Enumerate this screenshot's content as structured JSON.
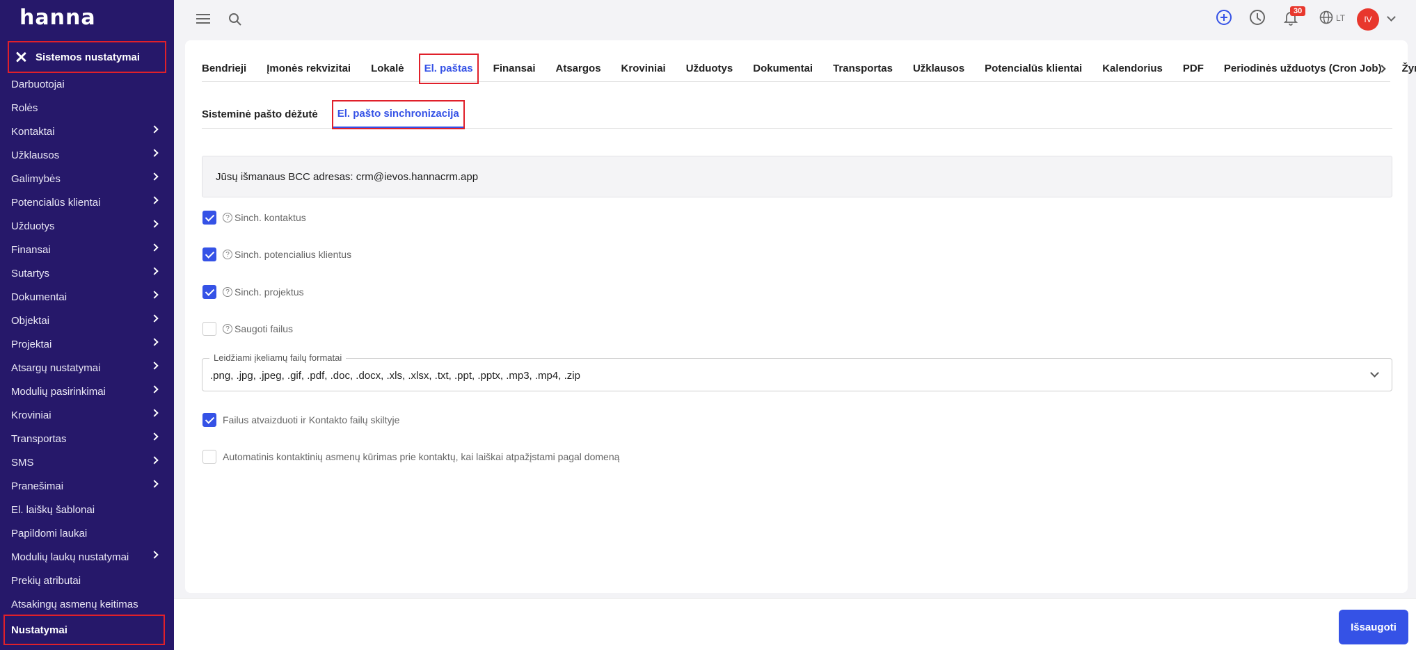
{
  "app": {
    "logo": "hanna"
  },
  "sidebar": {
    "header_label": "Sistemos nustatymai",
    "items": [
      {
        "label": "Darbuotojai",
        "chevron": false
      },
      {
        "label": "Rolės",
        "chevron": false
      },
      {
        "label": "Kontaktai",
        "chevron": true
      },
      {
        "label": "Užklausos",
        "chevron": true
      },
      {
        "label": "Galimybės",
        "chevron": true
      },
      {
        "label": "Potencialūs klientai",
        "chevron": true
      },
      {
        "label": "Užduotys",
        "chevron": true
      },
      {
        "label": "Finansai",
        "chevron": true
      },
      {
        "label": "Sutartys",
        "chevron": true
      },
      {
        "label": "Dokumentai",
        "chevron": true
      },
      {
        "label": "Objektai",
        "chevron": true
      },
      {
        "label": "Projektai",
        "chevron": true
      },
      {
        "label": "Atsargų nustatymai",
        "chevron": true
      },
      {
        "label": "Modulių pasirinkimai",
        "chevron": true
      },
      {
        "label": "Kroviniai",
        "chevron": true
      },
      {
        "label": "Transportas",
        "chevron": true
      },
      {
        "label": "SMS",
        "chevron": true
      },
      {
        "label": "Pranešimai",
        "chevron": true
      },
      {
        "label": "El. laiškų šablonai",
        "chevron": false
      },
      {
        "label": "Papildomi laukai",
        "chevron": false
      },
      {
        "label": "Modulių laukų nustatymai",
        "chevron": true
      },
      {
        "label": "Prekių atributai",
        "chevron": false
      },
      {
        "label": "Atsakingų asmenų keitimas",
        "chevron": false
      },
      {
        "label": "Nustatymai",
        "chevron": false,
        "active": true
      }
    ]
  },
  "topbar": {
    "notifications_count": "30",
    "language": "LT",
    "user_initials": "IV"
  },
  "tabs": {
    "items": [
      "Bendrieji",
      "Įmonės rekvizitai",
      "Lokalė",
      "El. paštas",
      "Finansai",
      "Atsargos",
      "Kroviniai",
      "Užduotys",
      "Dokumentai",
      "Transportas",
      "Užklausos",
      "Potencialūs klientai",
      "Kalendorius",
      "PDF",
      "Periodinės užduotys (Cron Job)",
      "Žymės"
    ],
    "active_index": 3
  },
  "subtabs": {
    "items": [
      "Sisteminė pašto dėžutė",
      "El. pašto sinchronizacija"
    ],
    "active_index": 1
  },
  "info": {
    "bcc_text": "Jūsų išmanaus BCC adresas: crm@ievos.hannacrm.app"
  },
  "options": {
    "sync_contacts": {
      "label": "Sinch. kontaktus",
      "checked": true
    },
    "sync_leads": {
      "label": "Sinch. potencialius klientus",
      "checked": true
    },
    "sync_projects": {
      "label": "Sinch. projektus",
      "checked": true
    },
    "save_files": {
      "label": "Saugoti failus",
      "checked": false
    },
    "show_in_contact_files": {
      "label": "Failus atvaizduoti ir Kontakto failų skiltyje",
      "checked": true
    },
    "auto_create_contacts": {
      "label": "Automatinis kontaktinių asmenų kūrimas prie kontaktų, kai laiškai atpažįstami pagal domeną",
      "checked": false
    }
  },
  "file_formats": {
    "label": "Leidžiami įkeliamų failų formatai",
    "value": ".png, .jpg, .jpeg, .gif, .pdf, .doc, .docx, .xls, .xlsx, .txt, .ppt, .pptx, .mp3, .mp4, .zip"
  },
  "footer": {
    "save_label": "Išsaugoti"
  }
}
